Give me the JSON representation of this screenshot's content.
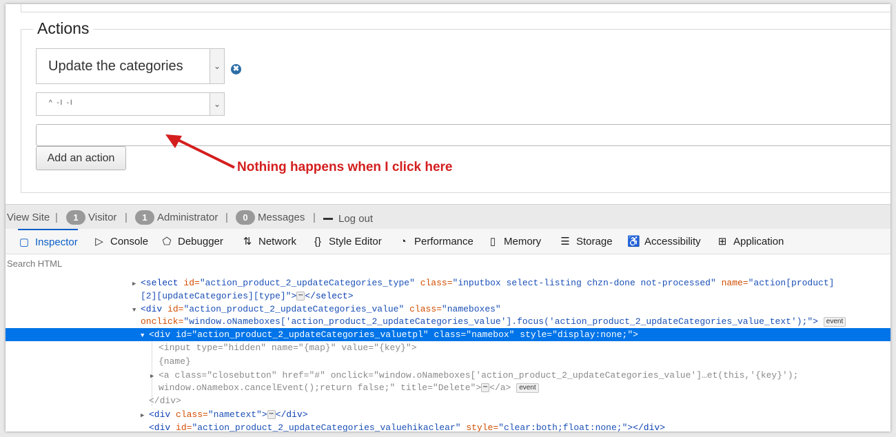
{
  "form": {
    "legend": "Actions",
    "action_select_value": "Update the categories",
    "type_select_value": "^ -l -l",
    "namebox_value": "",
    "add_button_label": "Add an action"
  },
  "annotation": {
    "text": "Nothing happens when I click here",
    "color": "#d41e1e"
  },
  "adminbar": {
    "view_site": "View Site",
    "separator": "|",
    "visitor_count": "1",
    "visitor_label": "Visitor",
    "administrator_count": "1",
    "administrator_label": "Administrator",
    "messages_count": "0",
    "messages_label": "Messages",
    "logout_label": "Log out"
  },
  "devtools": {
    "tabs": [
      {
        "label": "Inspector",
        "icon": "inspector-icon",
        "glyph": "▢"
      },
      {
        "label": "Console",
        "icon": "console-icon",
        "glyph": "▷"
      },
      {
        "label": "Debugger",
        "icon": "debugger-icon",
        "glyph": "⬠"
      },
      {
        "label": "Network",
        "icon": "network-icon",
        "glyph": "⇅"
      },
      {
        "label": "Style Editor",
        "icon": "style-editor-icon",
        "glyph": "{}"
      },
      {
        "label": "Performance",
        "icon": "performance-icon",
        "glyph": "◔"
      },
      {
        "label": "Memory",
        "icon": "memory-icon",
        "glyph": "▯"
      },
      {
        "label": "Storage",
        "icon": "storage-icon",
        "glyph": "☰"
      },
      {
        "label": "Accessibility",
        "icon": "accessibility-icon",
        "glyph": "♿"
      },
      {
        "label": "Application",
        "icon": "application-icon",
        "glyph": "⊞"
      }
    ],
    "active_tab": "Inspector",
    "search_placeholder": "Search HTML",
    "accent": "#0b5ec7",
    "selection_color": "#0074e8"
  },
  "code": {
    "l1_open": "<select",
    "l1_a1": "id=",
    "l1_v1": "\"action_product_2_updateCategories_type\"",
    "l1_a2": "class=",
    "l1_v2": "\"inputbox select-listing chzn-done not-processed\"",
    "l1_a3": "name=",
    "l1_v3": "\"action[product]",
    "l2_v": "[2][updateCategories][type]\"",
    "l2_gt": ">",
    "l2_ell": "⋯",
    "l2_close": "</select>",
    "l3_open": "<div",
    "l3_a1": "id=",
    "l3_v1": "\"action_product_2_updateCategories_value\"",
    "l3_a2": "class=",
    "l3_v2": "\"nameboxes\"",
    "l4_a": "onclick=",
    "l4_v": "\"window.oNameboxes['action_product_2_updateCategories_value'].focus('action_product_2_updateCategories_value_text');\"",
    "l4_gt": ">",
    "event_label": "event",
    "l5_text": "<div id=\"action_product_2_updateCategories_valuetpl\" class=\"namebox\" style=\"display:none;\">",
    "l6_open": "<input",
    "l6_a1": "type=",
    "l6_v1": "\"hidden\"",
    "l6_a2": "name=",
    "l6_v2": "\"{map}\"",
    "l6_a3": "value=",
    "l6_v3": "\"{key}\"",
    "l6_gt": ">",
    "l7_text": "{name}",
    "l8_open": "<a",
    "l8_a1": "class=",
    "l8_v1": "\"closebutton\"",
    "l8_a2": "href=",
    "l8_v2": "\"#\"",
    "l8_a3": "onclick=",
    "l8_v3": "\"window.oNameboxes['action_product_2_updateCategories_value']…et(this,'{key}');",
    "l9_v": "window.oNamebox.cancelEvent();return false;\"",
    "l9_a": "title=",
    "l9_v2": "\"Delete\"",
    "l9_gt": ">",
    "l9_ell": "⋯",
    "l9_close": "</a>",
    "l10_text": "</div>",
    "l11_open": "<div",
    "l11_a": "class=",
    "l11_v": "\"nametext\"",
    "l11_gt": ">",
    "l11_ell": "⋯",
    "l11_close": "</div>",
    "l12_open": "<div",
    "l12_a1": "id=",
    "l12_v1": "\"action_product_2_updateCategories_valuehikaclear\"",
    "l12_a2": "style=",
    "l12_v2": "\"clear:both;float:none;\"",
    "l12_gt": ">",
    "l12_close": "</div>"
  }
}
